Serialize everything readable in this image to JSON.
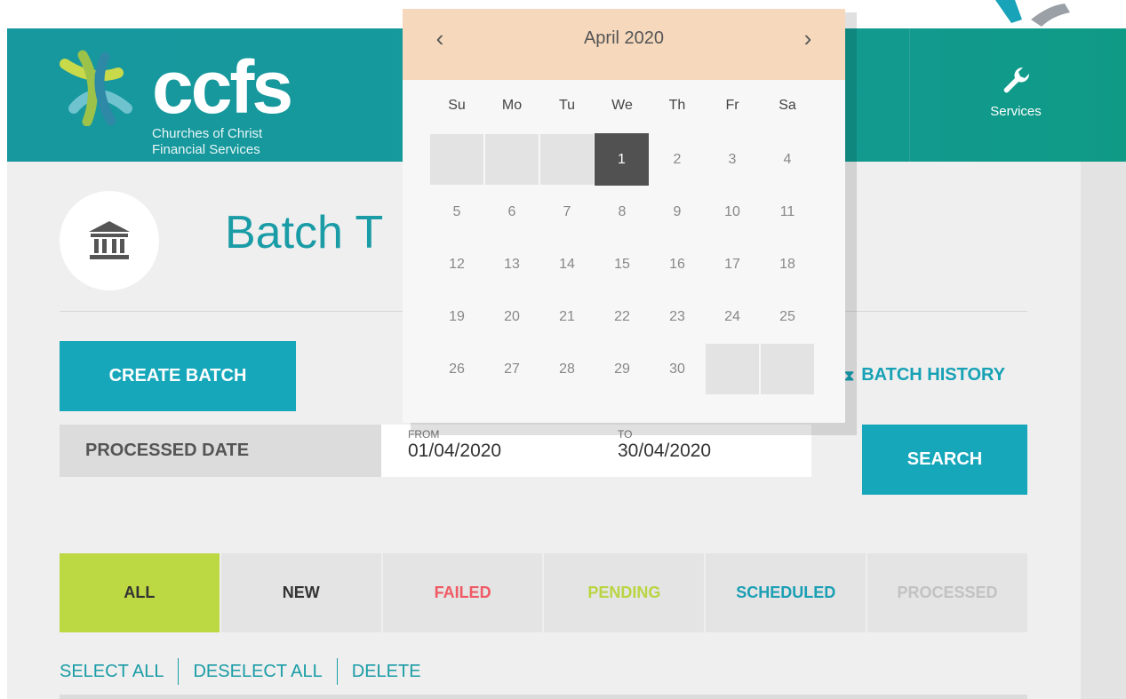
{
  "header": {
    "logo": {
      "text": "ccfs",
      "sub_line1": "Churches of Christ",
      "sub_line2": "Financial Services"
    },
    "services_label": "Services"
  },
  "page": {
    "title": "Batch T",
    "create_batch_label": "CREATE BATCH",
    "batch_history_label": "BATCH HISTORY",
    "processed_date_label": "PROCESSED DATE",
    "from_caption": "FROM",
    "from_value": "01/04/2020",
    "to_caption": "TO",
    "to_value": "30/04/2020",
    "search_label": "SEARCH"
  },
  "tabs": [
    {
      "label": "ALL",
      "color": "#333333",
      "bg": "#bcd843"
    },
    {
      "label": "NEW",
      "color": "#333333",
      "bg": "#e4e4e4"
    },
    {
      "label": "FAILED",
      "color": "#ef5a64",
      "bg": "#e4e4e4"
    },
    {
      "label": "PENDING",
      "color": "#b9d542",
      "bg": "#e4e4e4"
    },
    {
      "label": "SCHEDULED",
      "color": "#1a9fb4",
      "bg": "#e4e4e4"
    },
    {
      "label": "PROCESSED",
      "color": "#c2c2c2",
      "bg": "#e4e4e4"
    }
  ],
  "actions": {
    "select_all": "SELECT ALL",
    "deselect_all": "DESELECT ALL",
    "delete": "DELETE"
  },
  "datepicker": {
    "month_label": "April 2020",
    "prev": "‹",
    "next": "›",
    "weekdays": [
      "Su",
      "Mo",
      "Tu",
      "We",
      "Th",
      "Fr",
      "Sa"
    ],
    "leading_blanks": 3,
    "days_in_month": 30,
    "selected_day": 1
  },
  "colors": {
    "brand_teal": "#17a7ba",
    "header_teal": "#17979e",
    "lime": "#bcd843",
    "datepicker_header": "#f6d8bc"
  }
}
